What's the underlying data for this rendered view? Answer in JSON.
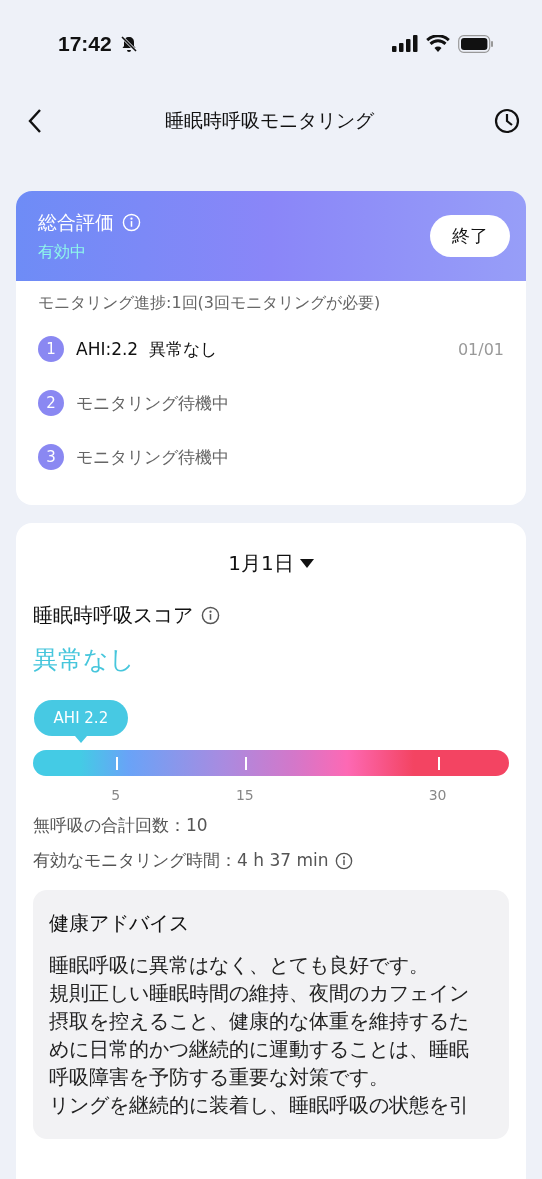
{
  "status_bar": {
    "time": "17:42"
  },
  "nav": {
    "title": "睡眠時呼吸モニタリング"
  },
  "evaluation": {
    "title": "総合評価",
    "status": "有効中",
    "end_button": "終了",
    "progress": "モニタリング進捗:1回(3回モニタリングが必要)",
    "steps": [
      {
        "number": "1",
        "kind": "done",
        "text": "AHI:2.2  異常なし",
        "date": "01/01"
      },
      {
        "number": "2",
        "kind": "pending",
        "text": "モニタリング待機中"
      },
      {
        "number": "3",
        "kind": "pending",
        "text": "モニタリング待機中"
      }
    ]
  },
  "report": {
    "date": "1月1日",
    "score_title": "睡眠時呼吸スコア",
    "result": "異常なし",
    "marker": "AHI 2.2",
    "ticks": [
      "5",
      "15",
      "30"
    ],
    "apnea_count": "無呼吸の合計回数：10",
    "monitoring_time": "有効なモニタリング時間：4 h 37 min",
    "advice": {
      "title": "健康アドバイス",
      "paragraphs": [
        "睡眠呼吸に異常はなく、とても良好です。",
        "規則正しい睡眠時間の維持、夜間のカフェイン摂取を控えること、健康的な体重を維持するために日常的かつ継続的に運動することは、睡眠呼吸障害を予防する重要な対策です。",
        "リングを継続的に装着し、睡眠呼吸の状態を引"
      ]
    }
  }
}
